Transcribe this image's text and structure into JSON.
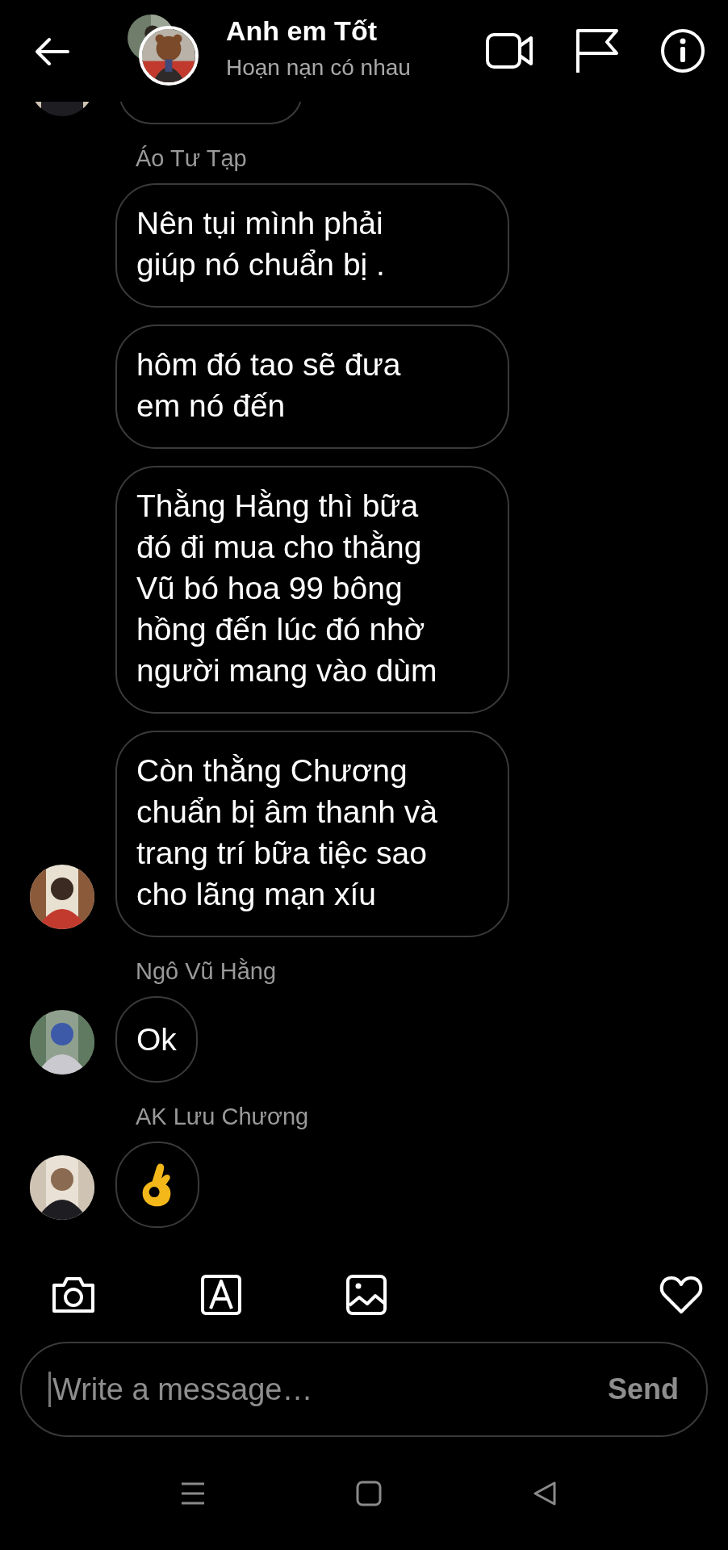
{
  "header": {
    "title": "Anh em Tốt",
    "subtitle": "Hoạn nạn có nhau"
  },
  "earlier_messages_cut": true,
  "groups": [
    {
      "sender": "Áo Tư Tạp",
      "messages": [
        {
          "kind": "text",
          "text": "Nên tụi mình phải giúp nó chuẩn bị ."
        },
        {
          "kind": "text",
          "text": "hôm đó tao sẽ đưa em nó đến"
        },
        {
          "kind": "text",
          "text": "Thằng Hằng thì bữa đó đi mua cho thằng Vũ bó hoa 99 bông hồng đến lúc đó nhờ người mang vào dùm"
        },
        {
          "kind": "text",
          "text": "Còn thằng Chương chuẩn bị âm thanh và trang trí bữa tiệc sao cho lãng mạn xíu"
        }
      ]
    },
    {
      "sender": "Ngô Vũ Hằng",
      "messages": [
        {
          "kind": "text",
          "text": "Ok"
        }
      ]
    },
    {
      "sender": "AK Lưu Chương",
      "messages": [
        {
          "kind": "ok_hand"
        }
      ]
    }
  ],
  "composer": {
    "placeholder": "Write a message…",
    "send": "Send"
  }
}
